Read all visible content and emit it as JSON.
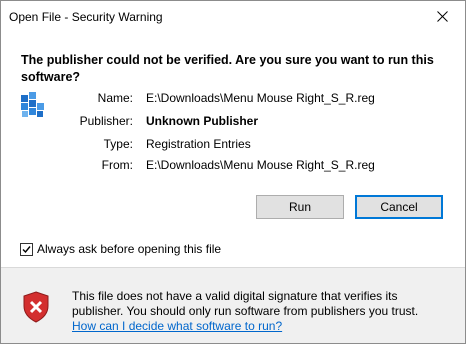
{
  "window": {
    "title": "Open File - Security Warning"
  },
  "headline": "The publisher could not be verified.  Are you sure you want to run this software?",
  "details": [
    {
      "label": "Name:",
      "value": "E:\\Downloads\\Menu Mouse Right_S_R.reg",
      "bold": false
    },
    {
      "label": "Publisher:",
      "value": "Unknown Publisher",
      "bold": true
    },
    {
      "label": "Type:",
      "value": "Registration Entries",
      "bold": false
    },
    {
      "label": "From:",
      "value": "E:\\Downloads\\Menu Mouse Right_S_R.reg",
      "bold": false
    }
  ],
  "buttons": {
    "run": "Run",
    "cancel": "Cancel"
  },
  "checkbox": {
    "label": "Always ask before opening this file",
    "checked": true
  },
  "warning": {
    "text": "This file does not have a valid digital signature that verifies its publisher.  You should only run software from publishers you trust.",
    "link": "How can I decide what software to run?"
  },
  "icons": {
    "close": "close-icon",
    "file": "registry-file-icon",
    "shield": "shield-error-icon"
  },
  "colors": {
    "link": "#0066cc",
    "default_button_border": "#0078d7",
    "shield_red": "#d32f2f",
    "footer_bg": "#f0f0f0"
  }
}
